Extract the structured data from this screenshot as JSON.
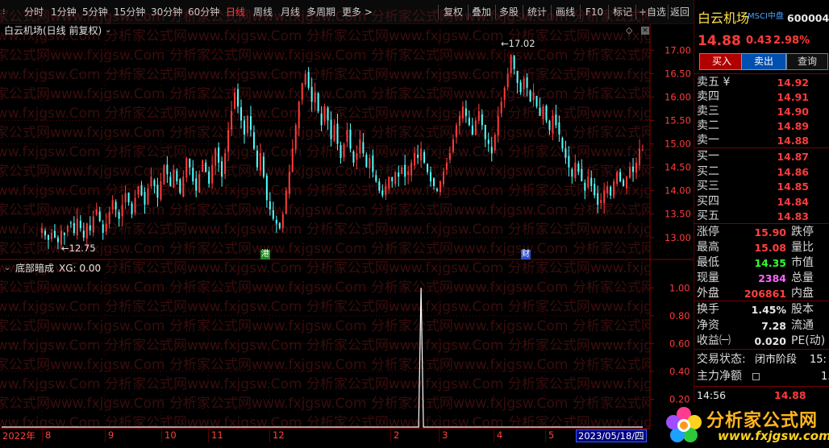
{
  "toolbar": {
    "periods": [
      "分时",
      "1分钟",
      "5分钟",
      "15分钟",
      "30分钟",
      "60分钟",
      "日线",
      "周线",
      "月线",
      "多周期",
      "更多 >"
    ],
    "active_period": "日线",
    "actions": [
      "复权",
      "叠加",
      "多股",
      "统计",
      "画线",
      "F10",
      "标记",
      "+自选",
      "返回"
    ]
  },
  "main_chart": {
    "title": "白云机场(日线 前复权)",
    "y_ticks": [
      "17.00",
      "16.50",
      "16.00",
      "15.50",
      "15.00",
      "14.50",
      "14.00",
      "13.50",
      "13.00"
    ],
    "low_marker": "12.75",
    "high_marker": "17.02",
    "badge_gang": "港",
    "badge_cai": "财"
  },
  "sub_chart": {
    "title": "底部暗成",
    "indicator": "XG: 0.00",
    "y_ticks": [
      "1.00",
      "0.80",
      "0.60",
      "0.40",
      "0.20"
    ]
  },
  "x_axis": {
    "labels": [
      "2022年",
      "8",
      "9",
      "10",
      "11",
      "12",
      "2",
      "3",
      "4",
      "5"
    ],
    "cursor_date": "2023/05/18/四"
  },
  "watermark": "分析家公式网www.fxjgsw.Com",
  "chart_data": [
    {
      "type": "candlestick",
      "title": "白云机场(日线 前复权)",
      "ylim": [
        12.6,
        17.3
      ],
      "y_ticks": [
        13.0,
        13.5,
        14.0,
        14.5,
        15.0,
        15.5,
        16.0,
        16.5,
        17.0
      ],
      "y_tick_labels": [
        "13.00",
        "13.50",
        "14.00",
        "14.50",
        "15.00",
        "15.50",
        "16.00",
        "16.50",
        "17.00"
      ],
      "marked_low": 12.75,
      "marked_high": 17.02,
      "series": [
        {
          "close": [
            13.2,
            13.05,
            12.95,
            13.1,
            13.0,
            12.9,
            13.15,
            13.05,
            13.25,
            13.3,
            13.1,
            13.4,
            13.2,
            13.0,
            13.3,
            13.15,
            13.45,
            13.6,
            13.35,
            13.1,
            13.3,
            13.55,
            13.8,
            13.6,
            13.4,
            13.7,
            13.95,
            13.75,
            13.5,
            13.85,
            14.1,
            13.9,
            13.7,
            14.05,
            14.3,
            14.1,
            13.85,
            14.2,
            14.55,
            14.35,
            14.1,
            14.45,
            14.2,
            13.95,
            14.3,
            14.7,
            14.5,
            14.2,
            14.0,
            14.35,
            14.65,
            14.4,
            14.15,
            14.55,
            14.9,
            14.6,
            14.3,
            14.8,
            15.3,
            15.7,
            16.1,
            15.8,
            15.5,
            15.2,
            15.6,
            15.3,
            14.9,
            14.5,
            14.8,
            14.3,
            13.8,
            13.6,
            13.4,
            13.3,
            13.2,
            13.5,
            14.0,
            14.4,
            14.9,
            15.4,
            15.9,
            16.3,
            16.5,
            16.2,
            15.9,
            16.1,
            15.7,
            15.4,
            15.8,
            15.5,
            15.1,
            15.4,
            15.0,
            14.7,
            15.0,
            15.3,
            14.9,
            14.6,
            14.8,
            15.1,
            14.8,
            14.5,
            14.7,
            14.4,
            14.2,
            14.0,
            13.9,
            14.1,
            14.3,
            14.2,
            14.4,
            14.3,
            14.5,
            14.3,
            14.4,
            14.6,
            14.8,
            14.7,
            14.9,
            14.6,
            14.4,
            14.2,
            14.1,
            14.0,
            14.2,
            14.4,
            14.6,
            14.8,
            15.1,
            15.4,
            15.6,
            15.8,
            15.6,
            15.4,
            15.2,
            15.5,
            15.7,
            15.4,
            15.1,
            15.0,
            14.8,
            15.2,
            15.6,
            15.9,
            16.2,
            16.5,
            16.9,
            16.6,
            16.3,
            16.1,
            16.4,
            16.2,
            15.9,
            16.1,
            15.8,
            15.6,
            15.8,
            15.5,
            15.3,
            15.6,
            15.4,
            15.2,
            14.9,
            14.7,
            14.5,
            14.3,
            14.6,
            14.4,
            14.2,
            14.0,
            14.3,
            14.1,
            13.9,
            13.7,
            13.8,
            14.0,
            14.1,
            13.9,
            14.2,
            14.4,
            14.2,
            14.1,
            14.3,
            14.5,
            14.4,
            14.6,
            14.9,
            14.88
          ],
          "color_up": "#ff3b3b",
          "color_down": "#54ffff"
        }
      ]
    },
    {
      "type": "line",
      "title": "底部暗成",
      "ylim": [
        0,
        1.1
      ],
      "y_ticks": [
        0.2,
        0.4,
        0.6,
        0.8,
        1.0
      ],
      "y_tick_labels": [
        "0.20",
        "0.40",
        "0.60",
        "0.80",
        "1.00"
      ],
      "series": [
        {
          "name": "XG",
          "spike_index": 118,
          "spike_value": 1.0,
          "last_value": 0.0
        }
      ]
    }
  ],
  "panel": {
    "name": "白云机场",
    "tag": "MSCI中盘",
    "code": "600004",
    "price": "14.88",
    "change": "0.43",
    "change_pct": "2.98%",
    "btn_buy": "买入",
    "btn_sell": "卖出",
    "btn_query": "查询",
    "sell_levels": [
      {
        "label": "卖五 ¥",
        "price": "14.92"
      },
      {
        "label": "卖四",
        "price": "14.91"
      },
      {
        "label": "卖三",
        "price": "14.90"
      },
      {
        "label": "卖二",
        "price": "14.89"
      },
      {
        "label": "卖一",
        "price": "14.88"
      }
    ],
    "buy_levels": [
      {
        "label": "买一",
        "price": "14.87"
      },
      {
        "label": "买二",
        "price": "14.86"
      },
      {
        "label": "买三",
        "price": "14.85"
      },
      {
        "label": "买四",
        "price": "14.84"
      },
      {
        "label": "买五",
        "price": "14.83"
      }
    ],
    "stats1": [
      {
        "label": "涨停",
        "value": "15.90",
        "label2": "跌停",
        "color": "#ff4040"
      },
      {
        "label": "最高",
        "value": "15.08",
        "label2": "量比",
        "color": "#ff4040"
      },
      {
        "label": "最低",
        "value": "14.35",
        "label2": "市值",
        "color": "#33ff33"
      },
      {
        "label": "现量",
        "value": "2384",
        "label2": "总量",
        "color": "#ff66ff"
      },
      {
        "label": "外盘",
        "value": "206861",
        "label2": "内盘",
        "color": "#ff4040"
      }
    ],
    "stats2": [
      {
        "label": "换手",
        "value": "1.45%",
        "label2": "股本",
        "color": "#e8e8e8"
      },
      {
        "label": "净资",
        "value": "7.28",
        "label2": "流通",
        "color": "#e8e8e8"
      },
      {
        "label": "收益㈠",
        "value": "0.020",
        "label2": "PE(动)",
        "color": "#e8e8e8"
      }
    ],
    "trade_status_label": "交易状态:",
    "trade_status": "闭市阶段",
    "trade_status_tail": "15:",
    "main_flow_label": "主力净额",
    "main_flow_tail": "1.",
    "last_time": "14:56",
    "last_price": "14.88"
  },
  "logo": {
    "title": "分析家公式网",
    "url": "www.fxjgsw.com"
  }
}
